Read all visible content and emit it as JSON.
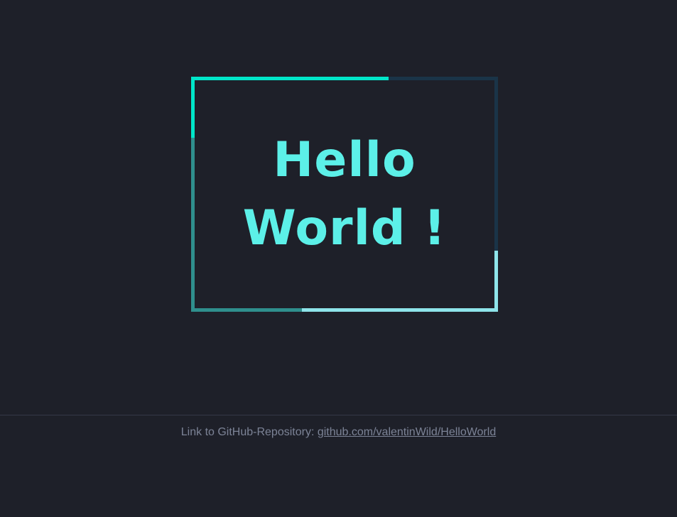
{
  "main": {
    "heading_line1": "Hello",
    "heading_line2": "World !"
  },
  "footer": {
    "link_prefix": "Link to GitHub-Repository: ",
    "link_text": "github.com/valentinWild/HelloWorld"
  },
  "colors": {
    "background": "#1e2029",
    "heading": "#5cf0e8",
    "frame_accent_1": "#00e6c9",
    "frame_accent_2": "#1a3448",
    "frame_accent_3": "#2f8f8d",
    "frame_accent_4": "#8ee4ea",
    "footer_text": "#7c8396"
  }
}
